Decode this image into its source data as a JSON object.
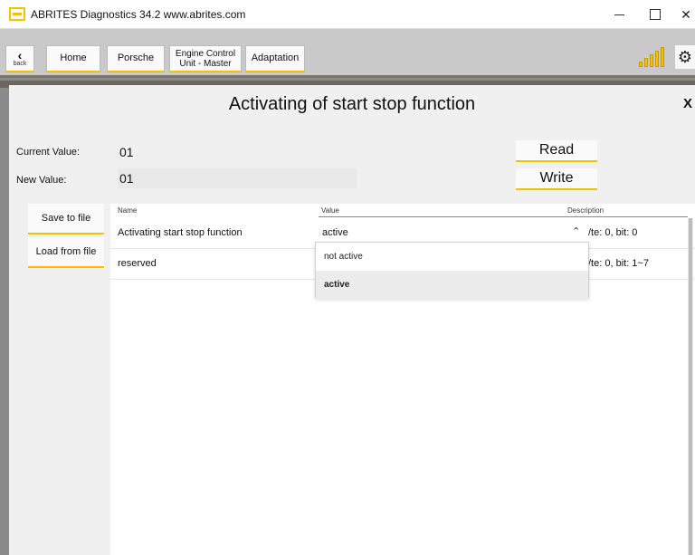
{
  "window": {
    "title": "ABRITES Diagnostics 34.2  www.abrites.com",
    "controls": [
      "minimize",
      "maximize",
      "close"
    ]
  },
  "nav": {
    "back_label": "back",
    "breadcrumb": [
      "Home",
      "Porsche",
      "Engine Control Unit - Master",
      "Adaptation"
    ],
    "ecu_line1": "Engine Control",
    "ecu_line2": "Unit - Master"
  },
  "icons": {
    "signal": "signal-strength-icon",
    "settings": "gear-icon",
    "back": "chevron-left-icon"
  },
  "panel": {
    "title": "Activating of start stop function",
    "close_label": "X",
    "current_value_label": "Current Value:",
    "current_value": "01",
    "new_value_label": "New Value:",
    "new_value": "01",
    "read_label": "Read",
    "write_label": "Write",
    "save_label": "Save to file",
    "load_label": "Load from file"
  },
  "table": {
    "headers": {
      "name": "Name",
      "value": "Value",
      "description": "Description"
    },
    "rows": [
      {
        "name": "Activating start stop function",
        "value": "active",
        "description": "/te: 0, bit: 0"
      },
      {
        "name": "reserved",
        "value": "",
        "description": "/te: 0, bit: 1~7"
      }
    ]
  },
  "dropdown": {
    "options": [
      "not active",
      "active"
    ],
    "selected": "active"
  },
  "colors": {
    "accent": "#f2c200",
    "nav_bg": "#c9c9c9",
    "panel_bg": "#f0f0f0"
  }
}
